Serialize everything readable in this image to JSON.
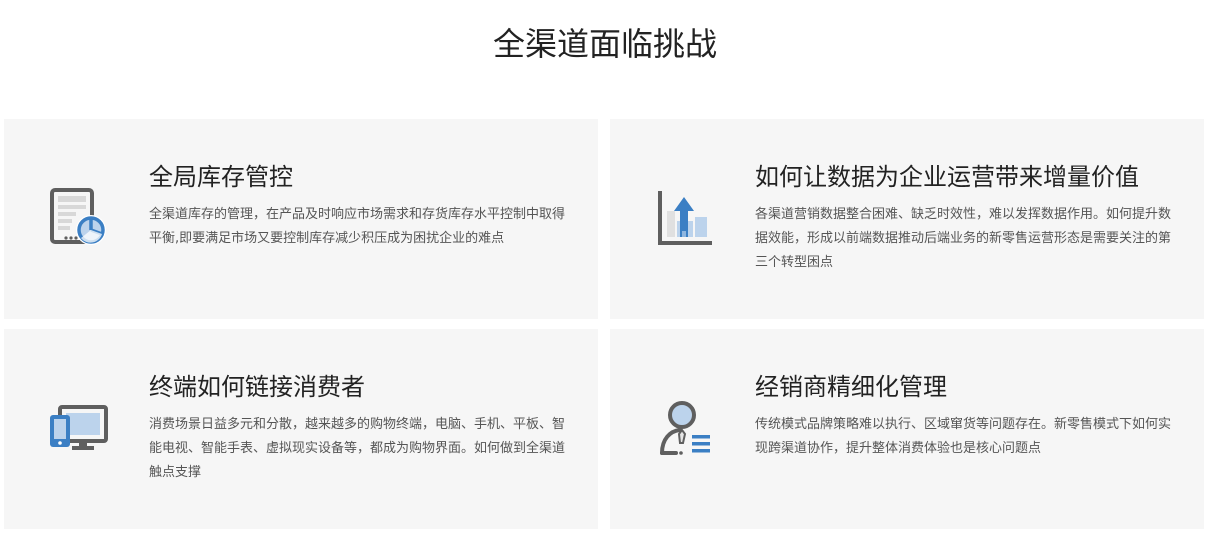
{
  "page": {
    "title": "全渠道面临挑战"
  },
  "colors": {
    "card_background": "#f6f6f6",
    "icon_gray": "#5f5f5f",
    "icon_blue": "#3b7fc4",
    "icon_light_blue": "#bcd3ec"
  },
  "cards": [
    {
      "icon": "tablet-pie-chart-icon",
      "title": "全局库存管控",
      "description": "全渠道库存的管理，在产品及时响应市场需求和存货库存水平控制中取得平衡,即要满足市场又要控制库存减少积压成为困扰企业的难点"
    },
    {
      "icon": "bar-chart-growth-icon",
      "title": "如何让数据为企业运营带来增量价值",
      "description": "各渠道营销数据整合困难、缺乏时效性，难以发挥数据作用。如何提升数据效能，形成以前端数据推动后端业务的新零售运营形态是需要关注的第三个转型困点"
    },
    {
      "icon": "devices-icon",
      "title": "终端如何链接消费者",
      "description": "消费场景日益多元和分散，越来越多的购物终端，电脑、手机、平板、智能电视、智能手表、虚拟现实设备等，都成为购物界面。如何做到全渠道触点支撑"
    },
    {
      "icon": "user-list-icon",
      "title": "经销商精细化管理",
      "description": "传统模式品牌策略难以执行、区域窜货等问题存在。新零售模式下如何实现跨渠道协作，提升整体消费体验也是核心问题点"
    }
  ]
}
